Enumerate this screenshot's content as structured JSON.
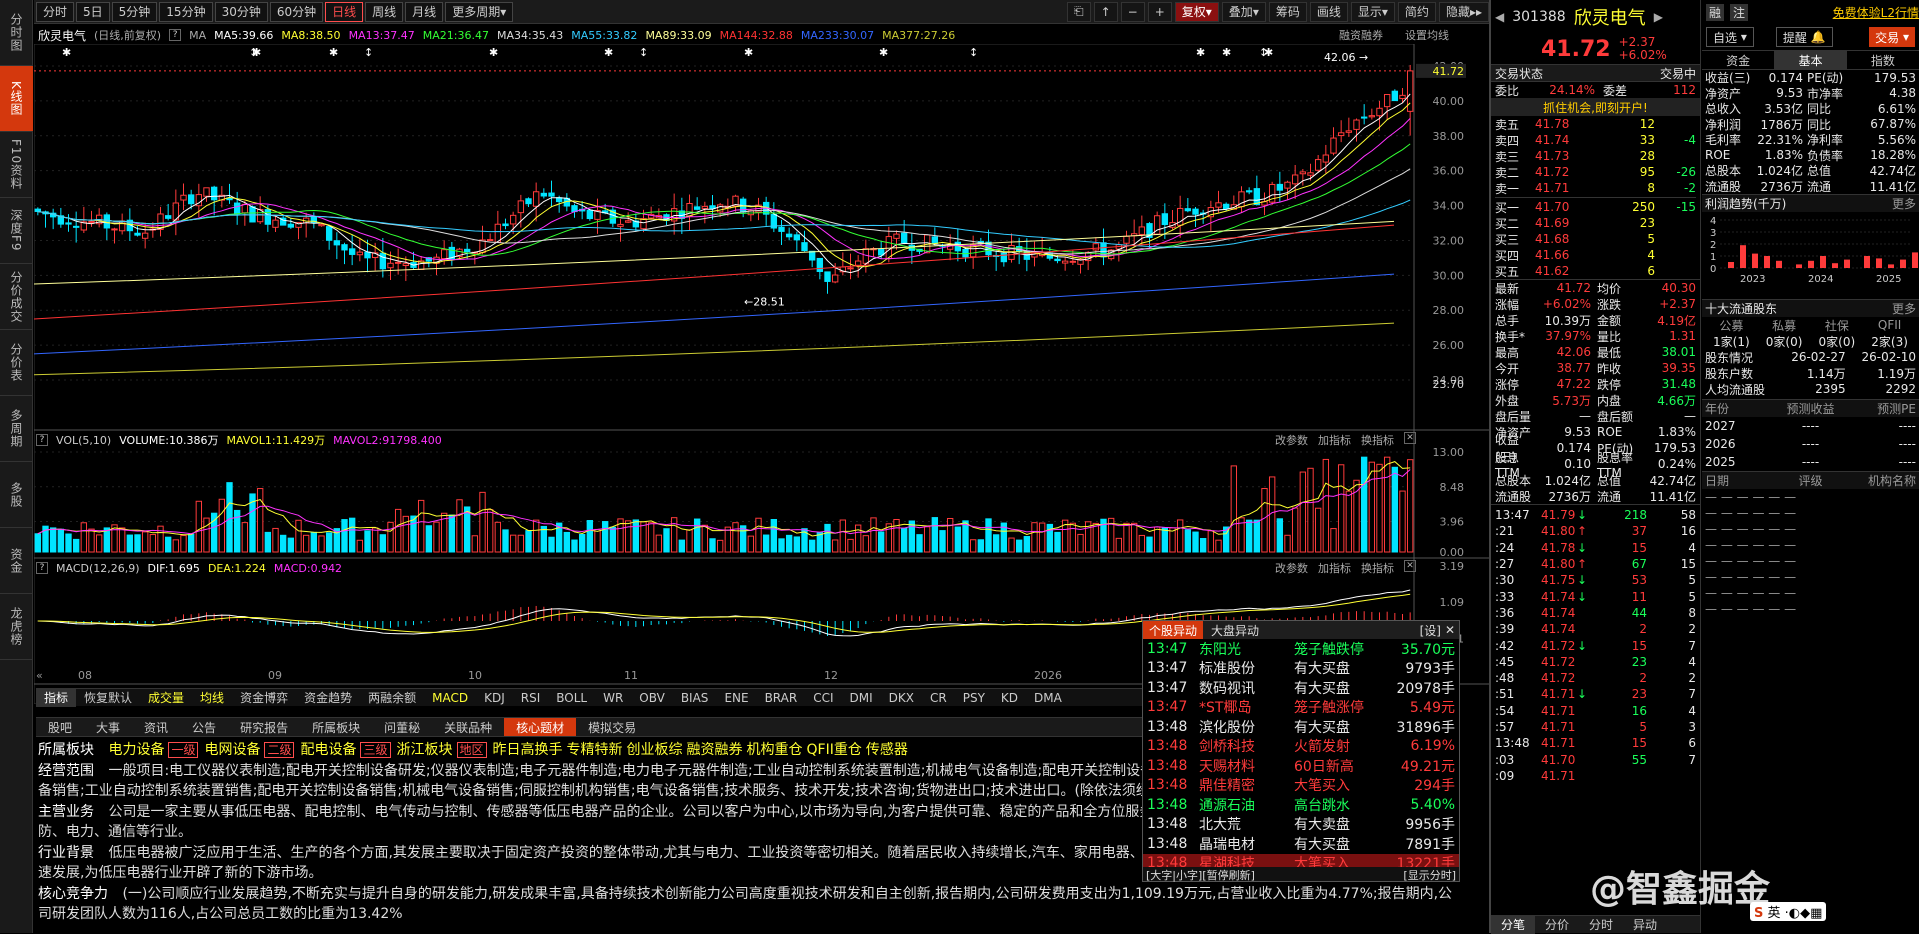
{
  "left_nav": [
    "分时图",
    "K线图",
    "F10资料",
    "深度F9",
    "分价成交",
    "分价表",
    "多周期",
    "多股",
    "资金",
    "龙虎榜"
  ],
  "periods": [
    "分时",
    "5日",
    "5分钟",
    "15分钟",
    "30分钟",
    "60分钟",
    "日线",
    "周线",
    "月线",
    "更多周期"
  ],
  "tools": [
    "复权",
    "叠加",
    "筹码",
    "画线",
    "显示",
    "简约",
    "隐藏"
  ],
  "chart_title": "欣灵电气",
  "chart_mode": "(日线,前复权)",
  "ma_label": "MA",
  "ma": [
    {
      "t": "MA5:39.66",
      "c": "#ffffff"
    },
    {
      "t": "MA8:38.50",
      "c": "#ffff33"
    },
    {
      "t": "MA13:37.47",
      "c": "#ff33ff"
    },
    {
      "t": "MA21:36.47",
      "c": "#33ff33"
    },
    {
      "t": "MA34:35.43",
      "c": "#dddddd"
    },
    {
      "t": "MA55:33.82",
      "c": "#33ccff"
    },
    {
      "t": "MA89:33.09",
      "c": "#ffff99"
    },
    {
      "t": "MA144:32.88",
      "c": "#ff3333"
    },
    {
      "t": "MA233:30.07",
      "c": "#3366ff"
    },
    {
      "t": "MA377:27.26",
      "c": "#cccc33"
    }
  ],
  "rz": "融资融券",
  "set_ma": "设置均线",
  "price_axis": [
    "42.00",
    "40.00",
    "38.00",
    "36.00",
    "34.00",
    "32.00",
    "30.00",
    "28.00",
    "26.00",
    "24.00"
  ],
  "price_high": "42.06",
  "price_low": "28.51",
  "cur_price_tag": "41.72",
  "low_tag": "23.70",
  "vol_head": [
    "VOL(5,10)",
    "VOLUME:10.386万",
    "MAVOL1:11.429万",
    "MAVOL2:91798.400"
  ],
  "vol_axis": [
    "13.00",
    "8.48",
    "3.96",
    "0.00"
  ],
  "macd_head": [
    "MACD(12,26,9)",
    "DIF:1.695",
    "DEA:1.224",
    "MACD:0.942"
  ],
  "macd_axis": [
    "3.19",
    "1.09",
    "-1.01"
  ],
  "ind_btns": [
    "改参数",
    "加指标",
    "换指标"
  ],
  "months": [
    "08",
    "09",
    "10",
    "11",
    "12",
    "2026"
  ],
  "ind_tabs": [
    "指标",
    "恢复默认",
    "成交量",
    "均线",
    "资金博弈",
    "资金趋势",
    "两融余额",
    "MACD",
    "KDJ",
    "RSI",
    "BOLL",
    "WR",
    "OBV",
    "BIAS",
    "ENE",
    "BRAR",
    "CCI",
    "DMI",
    "DKX",
    "CR",
    "PSY",
    "KD",
    "DMA"
  ],
  "bottom_tabs": [
    "股吧",
    "大事",
    "资讯",
    "公告",
    "研究报告",
    "所属板块",
    "问董秘",
    "关联品种",
    "核心题材",
    "模拟交易"
  ],
  "core": {
    "sector_label": "所属板块",
    "sectors": [
      "电力设备",
      "一级",
      "电网设备",
      "二级",
      "配电设备",
      "三级",
      "浙江板块",
      "地区",
      "昨日高换手",
      "专精特新",
      "创业板综",
      "融资融券",
      "机构重仓",
      "QFII重仓",
      "传感器"
    ],
    "scope_label": "经营范围",
    "scope": "一般项目:电工仪器仪表制造;配电开关控制设备研发;仪器仪表制造;电子元器件制造;电力电子元器件制造;工业自动控制系统装置制造;机械电气设备制造;配电开关控制设备制造;电工仪器仪表销售;电子元器件与机电组件设备销售;工业自动控制系统装置销售;配电开关控制设备销售;机械电气设备销售;伺服控制机构销售;电气设备销售;技术服务、技术开发;技术咨询;货物进出口;技术进出口。(除依法须经批准的项目外,凭营业执照依法自主开展经营活动)",
    "main_label": "主营业务",
    "main": "公司是一家主要从事低压电器、配电控制、电气传动与控制、传感器等低压电器产品的企业。公司以客户为中心,以市场为导向,为客户提供可靠、稳定的产品和全方位服务。产品广泛应用于机械制造、新能源、家电、消防、电力、通信等行业。",
    "bg_label": "行业背景",
    "bg": "低压电器被广泛应用于生活、生产的各个方面,其发展主要取决于固定资产投资的整体带动,尤其与电力、工业投资等密切相关。随着居民收入持续增长,汽车、家用电器、新能源、人工智能(AI)、智能制造等新兴产业的快速发展,为低压电器行业开辟了新的下游市场。",
    "core_label": "核心竞争力",
    "core": "(一)公司顺应行业发展趋势,不断充实与提升自身的研发能力,研发成果丰富,具备持续技术创新能力公司高度重视技术研发和自主创新,报告期内,公司研发费用支出为1,109.19万元,占营业收入比重为4.77%;报告期内,公司研发团队人数为116人,占公司总员工数的比重为13.42%"
  },
  "alert": {
    "tabs": [
      "个股异动",
      "大盘异动"
    ],
    "set": "[设]",
    "rows": [
      {
        "time": "13:47",
        "tc": "#1aff5a",
        "name": "东阳光",
        "nc": "#1aff5a",
        "ev": "笼子触跌停",
        "ec": "#1aff5a",
        "val": "35.70元",
        "vc": "#1aff5a"
      },
      {
        "time": "13:47",
        "tc": "#e8e8e8",
        "name": "标准股份",
        "nc": "#e8e8e8",
        "ev": "有大买盘",
        "ec": "#e8e8e8",
        "val": "9793手",
        "vc": "#e8e8e8"
      },
      {
        "time": "13:47",
        "tc": "#e8e8e8",
        "name": "数码视讯",
        "nc": "#e8e8e8",
        "ev": "有大买盘",
        "ec": "#e8e8e8",
        "val": "20978手",
        "vc": "#e8e8e8"
      },
      {
        "time": "13:47",
        "tc": "#ff3b3b",
        "name": "*ST椰岛",
        "nc": "#ff3b3b",
        "ev": "笼子触涨停",
        "ec": "#ff3b3b",
        "val": "5.49元",
        "vc": "#ff3b3b"
      },
      {
        "time": "13:48",
        "tc": "#e8e8e8",
        "name": "滨化股份",
        "nc": "#e8e8e8",
        "ev": "有大买盘",
        "ec": "#e8e8e8",
        "val": "31896手",
        "vc": "#e8e8e8"
      },
      {
        "time": "13:48",
        "tc": "#ff3b3b",
        "name": "剑桥科技",
        "nc": "#ff3b3b",
        "ev": "火箭发射",
        "ec": "#ff3b3b",
        "val": "6.19%",
        "vc": "#ff3b3b"
      },
      {
        "time": "13:48",
        "tc": "#ff3b3b",
        "name": "天赐材料",
        "nc": "#ff3b3b",
        "ev": "60日新高",
        "ec": "#ff3b3b",
        "val": "49.21元",
        "vc": "#ff3b3b"
      },
      {
        "time": "13:48",
        "tc": "#ff3b3b",
        "name": "鼎佳精密",
        "nc": "#ff3b3b",
        "ev": "大笔买入",
        "ec": "#ff3b3b",
        "val": "294手",
        "vc": "#ff3b3b"
      },
      {
        "time": "13:48",
        "tc": "#1aff5a",
        "name": "通源石油",
        "nc": "#1aff5a",
        "ev": "高台跳水",
        "ec": "#1aff5a",
        "val": "5.40%",
        "vc": "#1aff5a"
      },
      {
        "time": "13:48",
        "tc": "#e8e8e8",
        "name": "北大荒",
        "nc": "#e8e8e8",
        "ev": "有大卖盘",
        "ec": "#e8e8e8",
        "val": "9956手",
        "vc": "#e8e8e8"
      },
      {
        "time": "13:48",
        "tc": "#e8e8e8",
        "name": "晶瑞电材",
        "nc": "#e8e8e8",
        "ev": "有大买盘",
        "ec": "#e8e8e8",
        "val": "7891手",
        "vc": "#e8e8e8"
      },
      {
        "time": "13:48",
        "tc": "#ff3b3b",
        "name": "星湖科技",
        "nc": "#ff3b3b",
        "ev": "大笔买入",
        "ec": "#ff3b3b",
        "val": "13221手",
        "vc": "#ff3b3b"
      }
    ],
    "foot_left": "[大字|小字][暂停刷新]",
    "foot_right": "[显示分时]"
  },
  "stock": {
    "code": "301388",
    "name": "欣灵电气",
    "price": "41.72",
    "chg": "+2.37",
    "pct": "+6.02%",
    "badges": [
      "融",
      "注"
    ],
    "l2": "免费体验L2行情",
    "btns": [
      "自选",
      "提醒",
      "交易"
    ],
    "state_label": "交易状态",
    "state": "交易中",
    "wb_label": "委比",
    "wb": "24.14%",
    "wc_label": "委差",
    "wc": "112",
    "chance": "抓住机会,即刻开户!",
    "sells": [
      [
        "卖五",
        "41.78",
        "12",
        ""
      ],
      [
        "卖四",
        "41.74",
        "33",
        "-4"
      ],
      [
        "卖三",
        "41.73",
        "28",
        ""
      ],
      [
        "卖二",
        "41.72",
        "95",
        "-26"
      ],
      [
        "卖一",
        "41.71",
        "8",
        "-2"
      ]
    ],
    "buys": [
      [
        "买一",
        "41.70",
        "250",
        "-15"
      ],
      [
        "买二",
        "41.69",
        "23",
        ""
      ],
      [
        "买三",
        "41.68",
        "5",
        ""
      ],
      [
        "买四",
        "41.66",
        "4",
        ""
      ],
      [
        "买五",
        "41.62",
        "6",
        ""
      ]
    ],
    "stats": [
      [
        "最新",
        "41.72",
        "均价",
        "40.30"
      ],
      [
        "涨幅",
        "+6.02%",
        "涨跌",
        "+2.37"
      ],
      [
        "总手",
        "10.39万",
        "金额",
        "4.19亿"
      ],
      [
        "换手*",
        "37.97%",
        "量比",
        "1.31"
      ],
      [
        "最高",
        "42.06",
        "最低",
        "38.01"
      ],
      [
        "今开",
        "38.77",
        "昨收",
        "39.35"
      ],
      [
        "涨停",
        "47.22",
        "跌停",
        "31.48"
      ],
      [
        "外盘",
        "5.73万",
        "内盘",
        "4.66万"
      ],
      [
        "盘后量",
        "—",
        "盘后额",
        "—"
      ],
      [
        "净资产",
        "9.53",
        "ROE",
        "1.83%"
      ],
      [
        "收益(三)",
        "0.174",
        "PE(动)",
        "179.53"
      ],
      [
        "股息TTM",
        "0.10",
        "股息率TTM",
        "0.24%"
      ],
      [
        "总股本",
        "1.024亿",
        "总值",
        "42.74亿"
      ],
      [
        "流通股",
        "2736万",
        "流通",
        "11.41亿"
      ]
    ]
  },
  "ticks": [
    [
      "13:47",
      "41.79",
      "↓",
      "218",
      "58"
    ],
    [
      ":21",
      "41.80",
      "↑",
      "37",
      "16"
    ],
    [
      ":24",
      "41.78",
      "↓",
      "15",
      "4"
    ],
    [
      ":27",
      "41.80",
      "↑",
      "67",
      "15"
    ],
    [
      ":30",
      "41.75",
      "↓",
      "53",
      "5"
    ],
    [
      ":33",
      "41.74",
      "↓",
      "11",
      "5"
    ],
    [
      ":36",
      "41.74",
      "",
      "44",
      "8"
    ],
    [
      ":39",
      "41.74",
      "",
      "2",
      "2"
    ],
    [
      ":42",
      "41.72",
      "↓",
      "15",
      "7"
    ],
    [
      ":45",
      "41.72",
      "",
      "23",
      "4"
    ],
    [
      ":48",
      "41.72",
      "",
      "2",
      "2"
    ],
    [
      ":51",
      "41.71",
      "↓",
      "23",
      "7"
    ],
    [
      ":54",
      "41.71",
      "",
      "16",
      "4"
    ],
    [
      ":57",
      "41.71",
      "",
      "5",
      "3"
    ],
    [
      "13:48",
      "41.71",
      "",
      "15",
      "6"
    ],
    [
      ":03",
      "41.70",
      "",
      "55",
      "7"
    ],
    [
      ":09",
      "41.71",
      "",
      "",
      ""
    ]
  ],
  "tick_tabs": [
    "分笔",
    "分价",
    "分时",
    "异动"
  ],
  "fund": {
    "tabs": [
      "资金",
      "基本",
      "指数"
    ],
    "rows": [
      [
        "收益(三)",
        "0.174",
        "PE(动)",
        "179.53"
      ],
      [
        "净资产",
        "9.53",
        "市净率",
        "4.38"
      ],
      [
        "总收入",
        "3.53亿",
        "同比",
        "6.61%"
      ],
      [
        "净利润",
        "1786万",
        "同比",
        "67.87%"
      ],
      [
        "毛利率",
        "22.31%",
        "净利率",
        "5.56%"
      ],
      [
        "ROE",
        "1.83%",
        "负债率",
        "18.28%"
      ],
      [
        "总股本",
        "1.024亿",
        "总值",
        "42.74亿"
      ],
      [
        "流通股",
        "2736万",
        "流通",
        "11.41亿"
      ]
    ],
    "profit_title": "利润趋势(千万)",
    "more": "更多",
    "profit_years": [
      "2023",
      "2024",
      "2025"
    ],
    "profit_axis": [
      "4",
      "3",
      "2",
      "1",
      "0"
    ],
    "top10_title": "十大流通股东",
    "holder_head": [
      "公募",
      "私募",
      "社保",
      "QFII"
    ],
    "holder_vals": [
      "1家(1)",
      "0家(0)",
      "0家(0)",
      "2家(3)"
    ],
    "holder_rows": [
      [
        "股东情况",
        "26-02-27",
        "26-02-10"
      ],
      [
        "股东户数",
        "1.14万",
        "1.19万"
      ],
      [
        "人均流通股",
        "2395",
        "2292"
      ]
    ],
    "fc_head": [
      "年份",
      "预测收益",
      "预测PE"
    ],
    "fc_rows": [
      [
        "2027",
        "----",
        "----"
      ],
      [
        "2026",
        "----",
        "----"
      ],
      [
        "2025",
        "----",
        "----"
      ]
    ],
    "rate_head": [
      "日期",
      "评级",
      "机构名称"
    ]
  },
  "watermark": "@智鑫掘金",
  "ime": "英"
}
